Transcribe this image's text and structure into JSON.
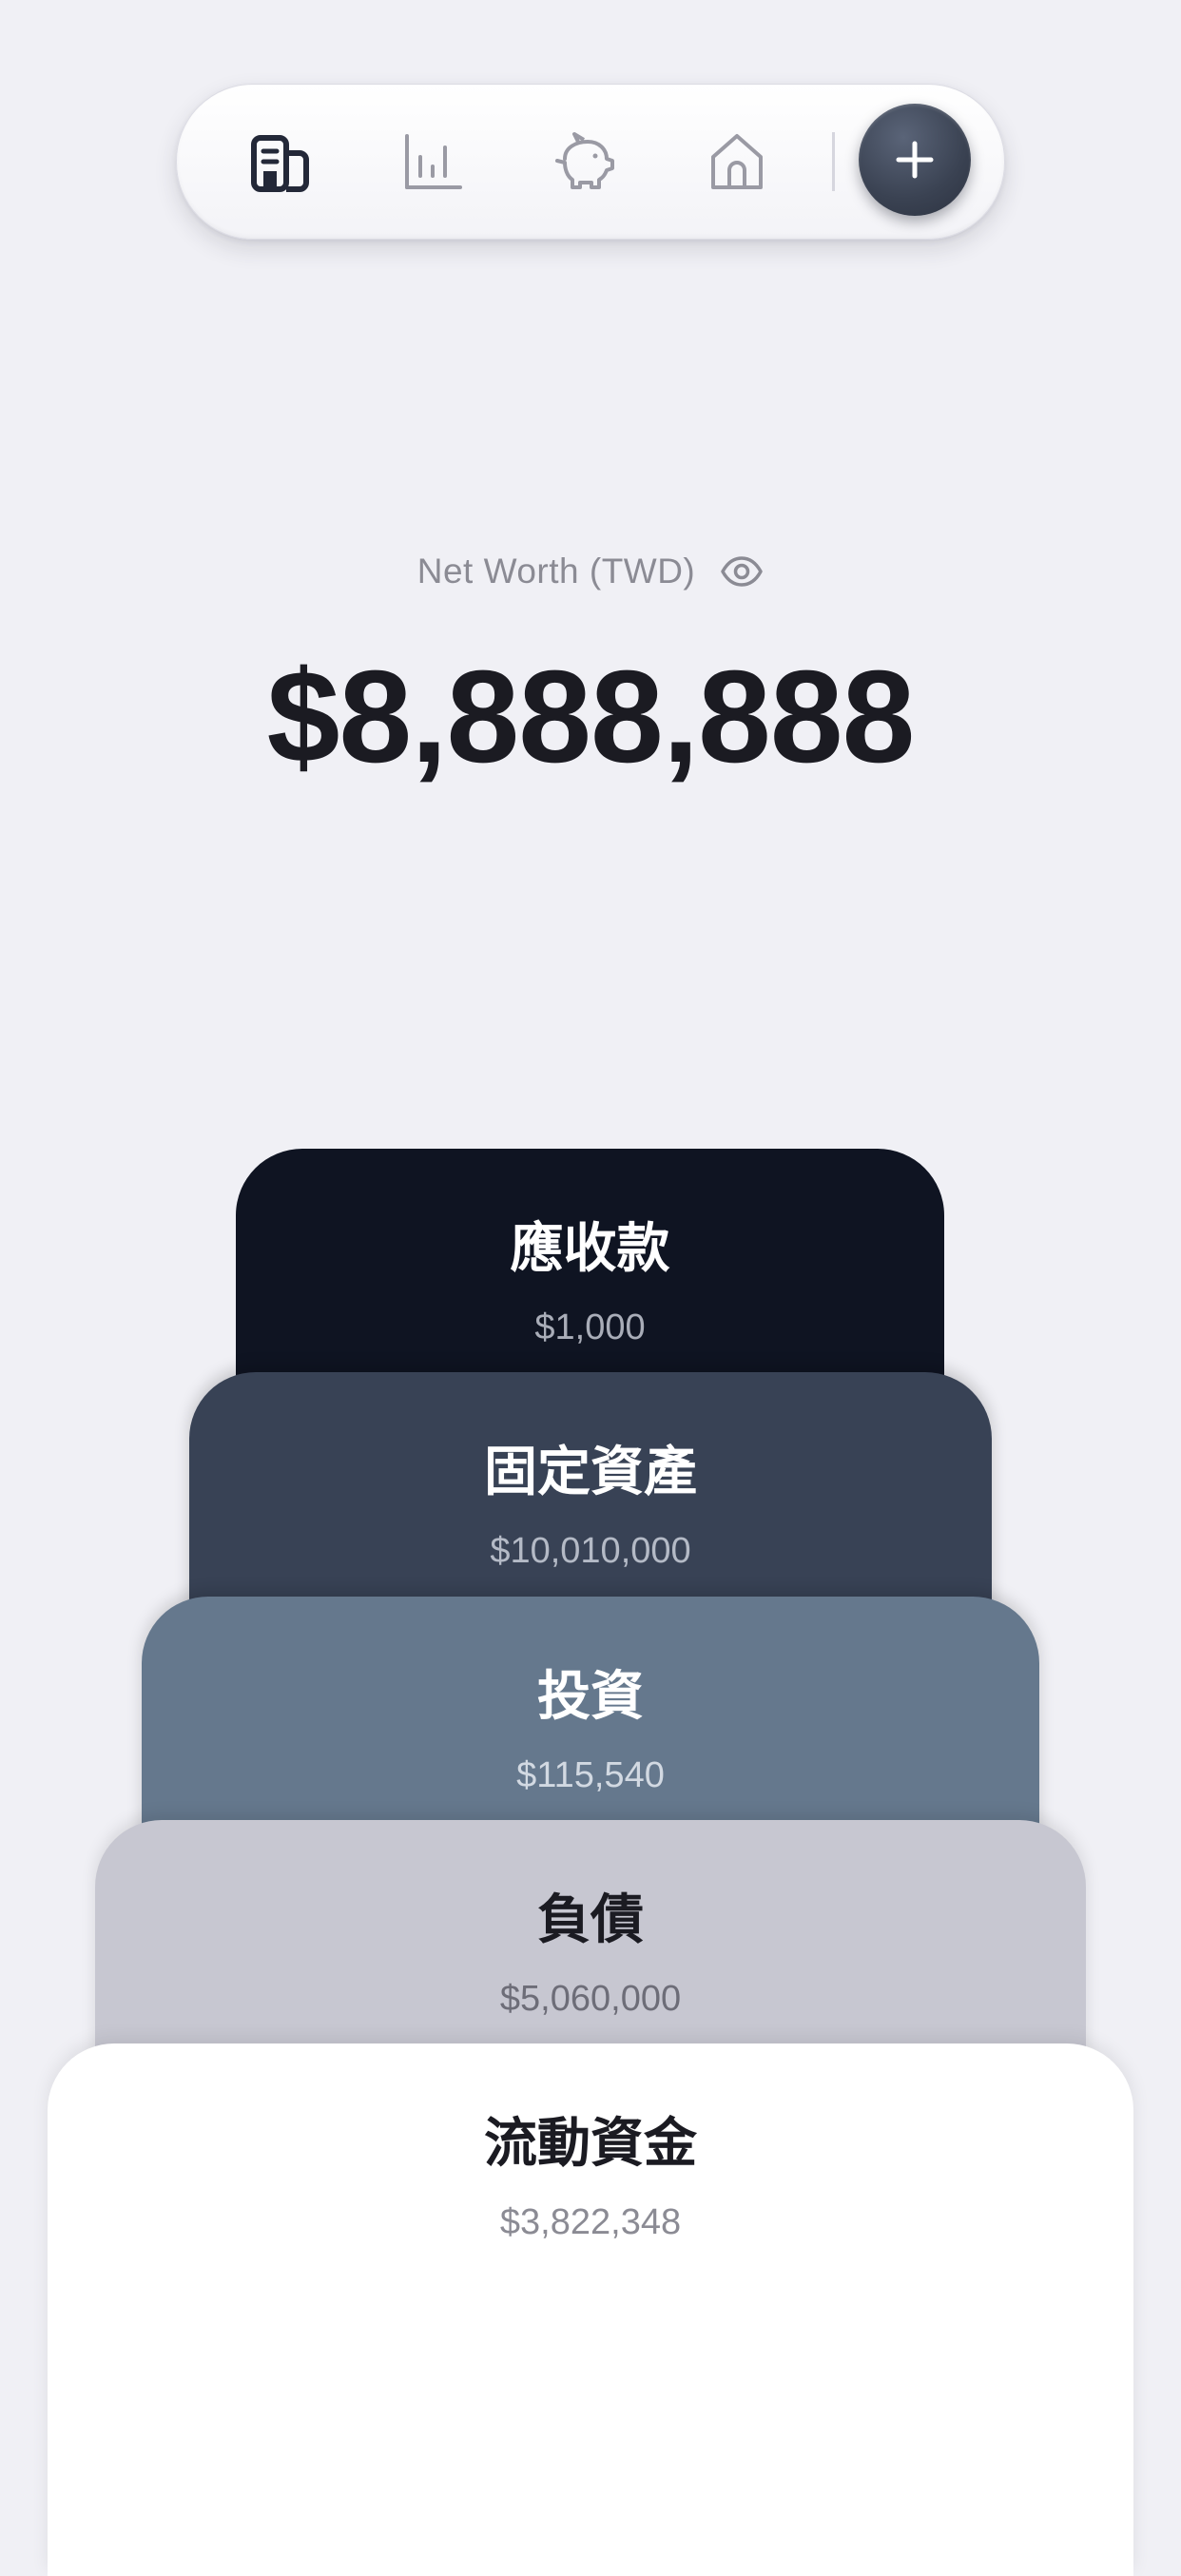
{
  "nav": {
    "items": [
      {
        "icon": "building-icon",
        "active": true
      },
      {
        "icon": "bar-chart-icon",
        "active": false
      },
      {
        "icon": "piggy-bank-icon",
        "active": false
      },
      {
        "icon": "home-icon",
        "active": false
      }
    ],
    "add_button_icon": "plus-icon"
  },
  "networth": {
    "label": "Net Worth (TWD)",
    "value": "$8,888,888",
    "visibility_icon": "eye-icon"
  },
  "cards": [
    {
      "title": "應收款",
      "amount": "$1,000"
    },
    {
      "title": "固定資產",
      "amount": "$10,010,000"
    },
    {
      "title": "投資",
      "amount": "$115,540"
    },
    {
      "title": "負債",
      "amount": "$5,060,000"
    },
    {
      "title": "流動資金",
      "amount": "$3,822,348"
    }
  ],
  "colors": {
    "background": "#f0f0f5",
    "card_receivables": "#0f1422",
    "card_fixed_assets": "#384255",
    "card_investments": "#65788d",
    "card_liabilities": "#c7c7d1",
    "card_liquid": "#ffffff"
  }
}
